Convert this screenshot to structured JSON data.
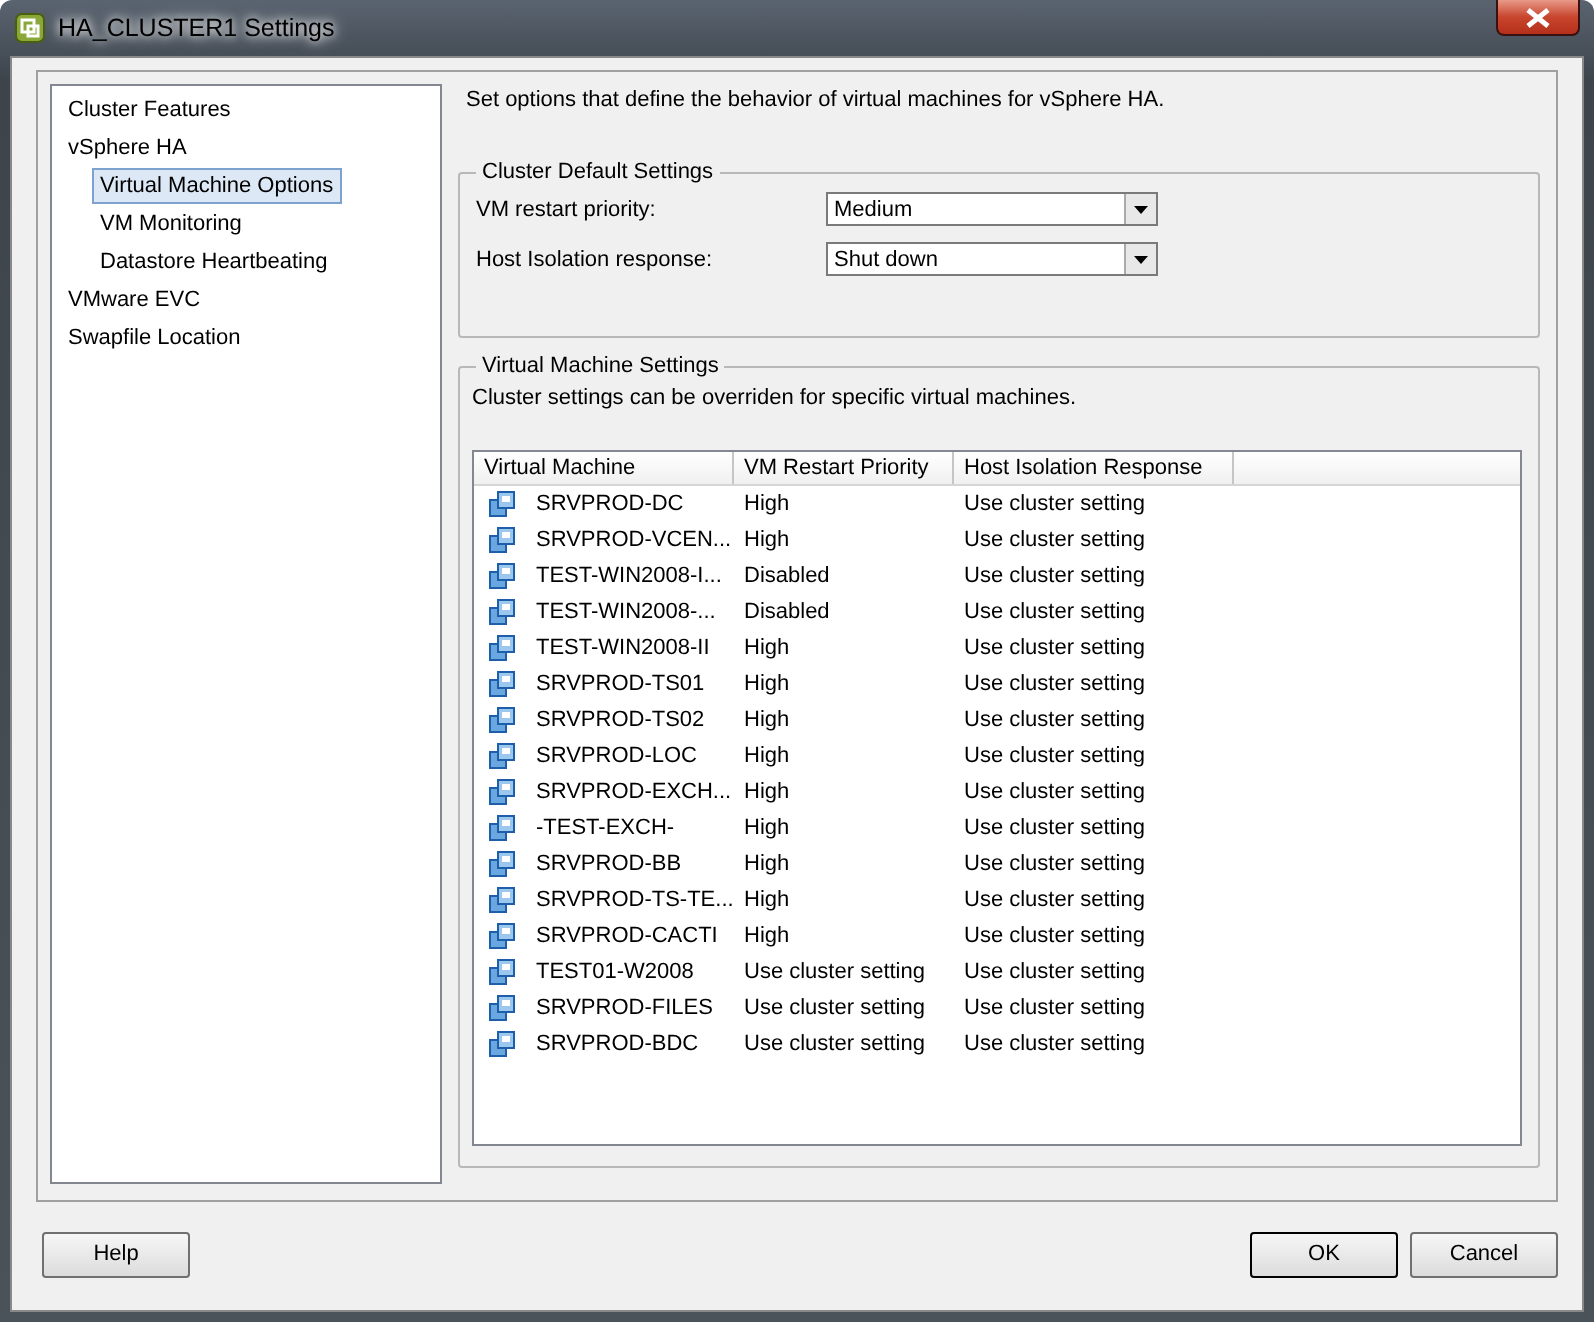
{
  "window": {
    "title": "HA_CLUSTER1 Settings"
  },
  "sidebar": {
    "items": [
      {
        "label": "Cluster Features",
        "selected": false
      },
      {
        "label": "vSphere HA",
        "selected": false,
        "children": [
          {
            "label": "Virtual Machine Options",
            "selected": true
          },
          {
            "label": "VM Monitoring",
            "selected": false
          },
          {
            "label": "Datastore Heartbeating",
            "selected": false
          }
        ]
      },
      {
        "label": "VMware EVC",
        "selected": false
      },
      {
        "label": "Swapfile Location",
        "selected": false
      }
    ]
  },
  "description": "Set options that define the behavior of virtual machines for vSphere HA.",
  "cluster_defaults": {
    "title": "Cluster Default Settings",
    "fields": [
      {
        "label": "VM restart priority:",
        "value": "Medium"
      },
      {
        "label": "Host Isolation response:",
        "value": "Shut down"
      }
    ]
  },
  "vm_settings": {
    "title": "Virtual Machine Settings",
    "note": "Cluster settings can be overriden for specific virtual machines.",
    "columns": [
      "Virtual Machine",
      "VM Restart Priority",
      "Host Isolation Response"
    ],
    "rows": [
      [
        "SRVPROD-DC",
        "High",
        "Use cluster setting"
      ],
      [
        "SRVPROD-VCEN...",
        "High",
        "Use cluster setting"
      ],
      [
        "TEST-WIN2008-I...",
        "Disabled",
        "Use cluster setting"
      ],
      [
        "TEST-WIN2008-...",
        "Disabled",
        "Use cluster setting"
      ],
      [
        "TEST-WIN2008-II",
        "High",
        "Use cluster setting"
      ],
      [
        "SRVPROD-TS01",
        "High",
        "Use cluster setting"
      ],
      [
        "SRVPROD-TS02",
        "High",
        "Use cluster setting"
      ],
      [
        "SRVPROD-LOC",
        "High",
        "Use cluster setting"
      ],
      [
        "SRVPROD-EXCH...",
        "High",
        "Use cluster setting"
      ],
      [
        "-TEST-EXCH-",
        "High",
        "Use cluster setting"
      ],
      [
        "SRVPROD-BB",
        "High",
        "Use cluster setting"
      ],
      [
        "SRVPROD-TS-TE...",
        "High",
        "Use cluster setting"
      ],
      [
        "SRVPROD-CACTI",
        "High",
        "Use cluster setting"
      ],
      [
        "TEST01-W2008",
        "Use cluster setting",
        "Use cluster setting"
      ],
      [
        "SRVPROD-FILES",
        "Use cluster setting",
        "Use cluster setting"
      ],
      [
        "SRVPROD-BDC",
        "Use cluster setting",
        "Use cluster setting"
      ]
    ]
  },
  "buttons": {
    "help": "Help",
    "ok": "OK",
    "cancel": "Cancel"
  }
}
